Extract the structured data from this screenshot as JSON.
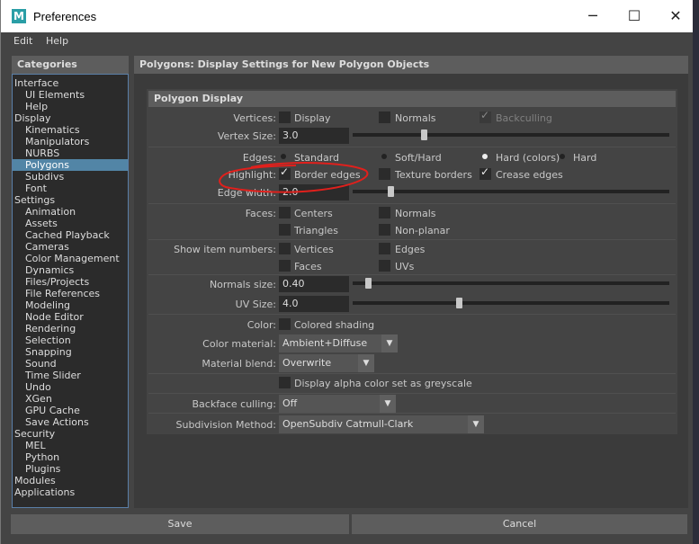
{
  "window": {
    "title": "Preferences",
    "icon_letter": "M",
    "minimize_glyph": "─",
    "maximize_glyph": "☐",
    "close_glyph": "✕"
  },
  "menu": [
    "Edit",
    "Help"
  ],
  "categories": {
    "header": "Categories",
    "items": [
      {
        "label": "Interface",
        "level": 0
      },
      {
        "label": "UI Elements",
        "level": 1
      },
      {
        "label": "Help",
        "level": 1
      },
      {
        "label": "Display",
        "level": 0
      },
      {
        "label": "Kinematics",
        "level": 1
      },
      {
        "label": "Manipulators",
        "level": 1
      },
      {
        "label": "NURBS",
        "level": 1
      },
      {
        "label": "Polygons",
        "level": 1,
        "selected": true
      },
      {
        "label": "Subdivs",
        "level": 1
      },
      {
        "label": "Font",
        "level": 1
      },
      {
        "label": "Settings",
        "level": 0
      },
      {
        "label": "Animation",
        "level": 1
      },
      {
        "label": "Assets",
        "level": 1
      },
      {
        "label": "Cached Playback",
        "level": 1
      },
      {
        "label": "Cameras",
        "level": 1
      },
      {
        "label": "Color Management",
        "level": 1
      },
      {
        "label": "Dynamics",
        "level": 1
      },
      {
        "label": "Files/Projects",
        "level": 1
      },
      {
        "label": "File References",
        "level": 1
      },
      {
        "label": "Modeling",
        "level": 1
      },
      {
        "label": "Node Editor",
        "level": 1
      },
      {
        "label": "Rendering",
        "level": 1
      },
      {
        "label": "Selection",
        "level": 1
      },
      {
        "label": "Snapping",
        "level": 1
      },
      {
        "label": "Sound",
        "level": 1
      },
      {
        "label": "Time Slider",
        "level": 1
      },
      {
        "label": "Undo",
        "level": 1
      },
      {
        "label": "XGen",
        "level": 1
      },
      {
        "label": "GPU Cache",
        "level": 1
      },
      {
        "label": "Save Actions",
        "level": 1
      },
      {
        "label": "Security",
        "level": 0
      },
      {
        "label": "MEL",
        "level": 1
      },
      {
        "label": "Python",
        "level": 1
      },
      {
        "label": "Plugins",
        "level": 1
      },
      {
        "label": "Modules",
        "level": 0
      },
      {
        "label": "Applications",
        "level": 0
      }
    ]
  },
  "panel": {
    "header": "Polygons: Display Settings for New Polygon Objects",
    "section": "Polygon Display",
    "vertices": {
      "label": "Vertices:",
      "display": {
        "label": "Display",
        "checked": false
      },
      "normals": {
        "label": "Normals",
        "checked": false
      },
      "backculling": {
        "label": "Backculling",
        "checked": true,
        "disabled": true
      }
    },
    "vertex_size": {
      "label": "Vertex Size:",
      "value": "3.0",
      "slider_fraction": 0.3
    },
    "edges": {
      "label": "Edges:",
      "options": [
        "Standard",
        "Soft/Hard",
        "Hard (colors)",
        "Hard"
      ],
      "selected": "Hard (colors)"
    },
    "highlight": {
      "label": "Highlight:",
      "border_edges": {
        "label": "Border edges",
        "checked": true
      },
      "texture_borders": {
        "label": "Texture borders",
        "checked": false
      },
      "crease_edges": {
        "label": "Crease edges",
        "checked": true
      }
    },
    "edge_width": {
      "label": "Edge width:",
      "value": "2.0",
      "slider_fraction": 0.14
    },
    "faces": {
      "label": "Faces:",
      "centers": {
        "label": "Centers",
        "checked": false
      },
      "normals": {
        "label": "Normals",
        "checked": false
      },
      "triangles": {
        "label": "Triangles",
        "checked": false
      },
      "non_planar": {
        "label": "Non-planar",
        "checked": false
      }
    },
    "show_item_numbers": {
      "label": "Show item numbers:",
      "vertices": {
        "label": "Vertices",
        "checked": false
      },
      "edges": {
        "label": "Edges",
        "checked": false
      },
      "faces": {
        "label": "Faces",
        "checked": false
      },
      "uvs": {
        "label": "UVs",
        "checked": false
      }
    },
    "normals_size": {
      "label": "Normals size:",
      "value": "0.40",
      "slider_fraction": 0.02
    },
    "uv_size": {
      "label": "UV Size:",
      "value": "4.0",
      "slider_fraction": 0.4
    },
    "color": {
      "label": "Color:",
      "colored_shading": {
        "label": "Colored shading",
        "checked": false
      }
    },
    "color_material": {
      "label": "Color material:",
      "value": "Ambient+Diffuse"
    },
    "material_blend": {
      "label": "Material blend:",
      "value": "Overwrite"
    },
    "alpha_greyscale": {
      "label": "Display alpha color set as greyscale",
      "checked": false
    },
    "backface_culling": {
      "label": "Backface culling:",
      "value": "Off"
    },
    "subdivision_method": {
      "label": "Subdivision Method:",
      "value": "OpenSubdiv Catmull-Clark"
    }
  },
  "buttons": {
    "save": "Save",
    "cancel": "Cancel"
  },
  "glyphs": {
    "check": "✓",
    "arrow_down": "▼"
  },
  "colors": {
    "selection": "#5285a6",
    "annotation": "#e0201c",
    "panel_bg": "#444444"
  }
}
